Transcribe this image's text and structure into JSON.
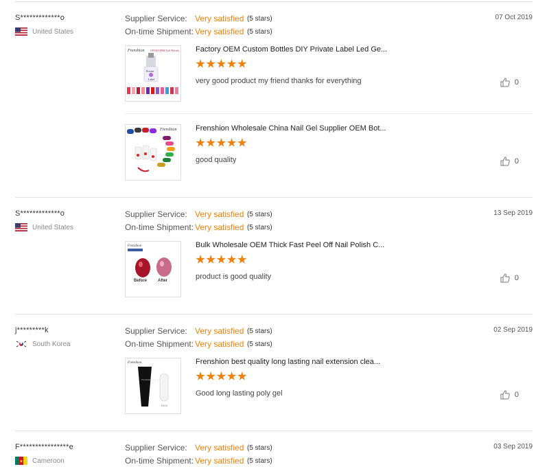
{
  "reviews": [
    {
      "buyer": "S*************o",
      "country": "United States",
      "supplier_service_label": "Supplier Service:",
      "supplier_service_value": "Very satisfied",
      "supplier_service_stars": "(5 stars)",
      "shipment_label": "On-time Shipment:",
      "shipment_value": "Very satisfied",
      "shipment_stars": "(5 stars)",
      "date": "07 Oct 2019",
      "products": [
        {
          "title": "Factory OEM Custom Bottles DIY Private Label Led Ge...",
          "rating": 5,
          "comment": "very good product my friend thanks for everything",
          "likes": "0"
        },
        {
          "title": "Frenshion Wholesale China Nail Gel Supplier OEM Bot...",
          "rating": 5,
          "comment": "good quality",
          "likes": "0"
        }
      ]
    },
    {
      "buyer": "S*************o",
      "country": "United States",
      "supplier_service_label": "Supplier Service:",
      "supplier_service_value": "Very satisfied",
      "supplier_service_stars": "(5 stars)",
      "shipment_label": "On-time Shipment:",
      "shipment_value": "Very satisfied",
      "shipment_stars": "(5 stars)",
      "date": "13 Sep 2019",
      "products": [
        {
          "title": "Bulk Wholesale OEM Thick Fast Peel Off Nail Polish C...",
          "rating": 5,
          "comment": "product is good quality",
          "likes": "0"
        }
      ]
    },
    {
      "buyer": "j*********k",
      "country": "South Korea",
      "supplier_service_label": "Supplier Service:",
      "supplier_service_value": "Very satisfied",
      "supplier_service_stars": "(5 stars)",
      "shipment_label": "On-time Shipment:",
      "shipment_value": "Very satisfied",
      "shipment_stars": "(5 stars)",
      "date": "02 Sep 2019",
      "products": [
        {
          "title": "Frenshion best quality long lasting nail extension clea...",
          "rating": 5,
          "comment": "Good long lasting poly gel",
          "likes": "0"
        }
      ]
    },
    {
      "buyer": "F****************e",
      "country": "Cameroon",
      "supplier_service_label": "Supplier Service:",
      "supplier_service_value": "Very satisfied",
      "supplier_service_stars": "(5 stars)",
      "shipment_label": "On-time Shipment:",
      "shipment_value": "Very satisfied",
      "shipment_stars": "(5 stars)",
      "date": "03 Sep 2019",
      "products": []
    }
  ],
  "thumb_text": {
    "brand": "Frenshion",
    "oem_line": "OEM/ODM  Gel Polish",
    "private_label": "Private Label",
    "before": "Before",
    "after": "After",
    "polygel_label": "Frenshion Poly gel",
    "polygel_code": "B815"
  },
  "colors": {
    "accent": "#f0800a",
    "divider": "#e2e2e2"
  }
}
